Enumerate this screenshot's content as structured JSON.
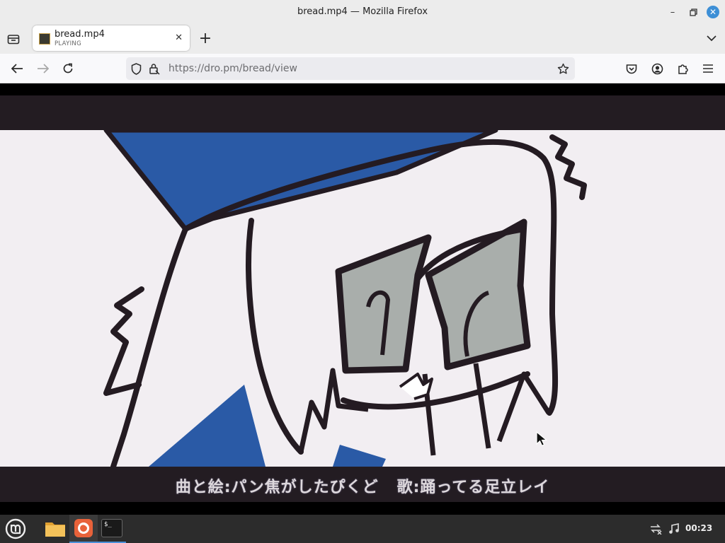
{
  "window": {
    "title": "bread.mp4 — Mozilla Firefox",
    "controls": [
      "minimize-icon",
      "restore-icon",
      "close-icon"
    ]
  },
  "tabs": [
    {
      "title": "bread.mp4",
      "subtitle": "PLAYING",
      "favicon": "video-thumbnail-icon",
      "active": true
    }
  ],
  "navbar": {
    "url": "https://dro.pm/bread/view",
    "icons": [
      "back-arrow-icon",
      "forward-arrow-icon",
      "reload-icon",
      "tracking-shield-icon",
      "lock-icon",
      "bookmark-star-icon",
      "pocket-icon",
      "account-icon",
      "extensions-icon",
      "menu-icon"
    ]
  },
  "video": {
    "credits_left": "曲と絵:パン焦がしたぴくど",
    "credits_right": "歌:踊ってる足立レイ"
  },
  "taskbar": {
    "apps": [
      "mint-menu-icon",
      "files-folder-icon",
      "firefox-icon",
      "terminal-icon"
    ],
    "terminal_glyph": "$_",
    "tray_icons": [
      "network-disconnected-icon",
      "music-note-icon"
    ],
    "clock": "00:23"
  },
  "colors": {
    "chrome_bg": "#ececec",
    "accent_blue": "#3d8fd6",
    "video_hair_blue": "#2a5aa6",
    "letterbox": "#231c22",
    "taskbar": "#2c2c2c"
  }
}
